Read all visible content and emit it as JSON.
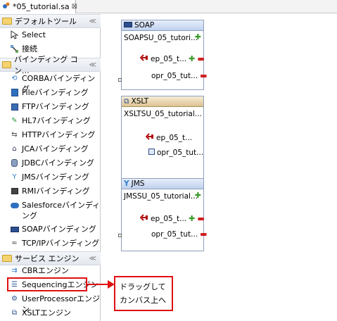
{
  "tab": {
    "title": "*05_tutorial.sa",
    "close": "⊠"
  },
  "palette": {
    "groups": [
      {
        "title": "デフォルトツール",
        "collapse": "≪",
        "items": [
          {
            "label": "Select",
            "icon": "select-arrow-icon"
          },
          {
            "label": "接続",
            "icon": "connect-icon"
          }
        ]
      },
      {
        "title": "バインディング コン...",
        "collapse": "≪",
        "items": [
          {
            "label": "CORBAバインディング",
            "icon": "corba-icon"
          },
          {
            "label": "Fileバインディング",
            "icon": "file-icon"
          },
          {
            "label": "FTPバインディング",
            "icon": "ftp-icon"
          },
          {
            "label": "HL7バインディング",
            "icon": "hl7-icon"
          },
          {
            "label": "HTTPバインディング",
            "icon": "http-icon"
          },
          {
            "label": "JCAバインディング",
            "icon": "jca-icon"
          },
          {
            "label": "JDBCバインディング",
            "icon": "jdbc-icon"
          },
          {
            "label": "JMSバインディング",
            "icon": "jms-icon"
          },
          {
            "label": "RMIバインディング",
            "icon": "rmi-icon"
          },
          {
            "label": "Salesforceバインディング",
            "icon": "salesforce-icon"
          },
          {
            "label": "SOAPバインディング",
            "icon": "soap-icon"
          },
          {
            "label": "TCP/IPバインディング",
            "icon": "tcpip-icon"
          }
        ]
      },
      {
        "title": "サービス エンジン",
        "collapse": "≪",
        "items": [
          {
            "label": "CBRエンジン",
            "icon": "cbr-icon"
          },
          {
            "label": "Sequencingエンジン",
            "icon": "sequencing-icon"
          },
          {
            "label": "UserProcessorエンジン",
            "icon": "userprocessor-icon"
          },
          {
            "label": "XSLTエンジン",
            "icon": "xslt-icon"
          }
        ]
      }
    ]
  },
  "canvas": {
    "nodes": [
      {
        "type": "SOAP",
        "name": "SOAPSU_05_tutori...",
        "endpoint": "ep_05_t...",
        "operation": "opr_05_tut..."
      },
      {
        "type": "XSLT",
        "name": "XSLTSU_05_tutorial...",
        "endpoint": "ep_05_t...",
        "operation": "opr_05_tut..."
      },
      {
        "type": "JMS",
        "name": "JMSSU_05_tutorial...",
        "endpoint": "ep_05_t...",
        "operation": "opr_05_tut..."
      }
    ]
  },
  "annotation": {
    "line1": "ドラッグして",
    "line2": "カンバス上へ",
    "color": "#e01010"
  },
  "colors": {
    "header_blue": "#bfd0ee",
    "header_tan": "#ddc392",
    "plus": "#3a9a2a",
    "minus": "#d01f1f"
  }
}
